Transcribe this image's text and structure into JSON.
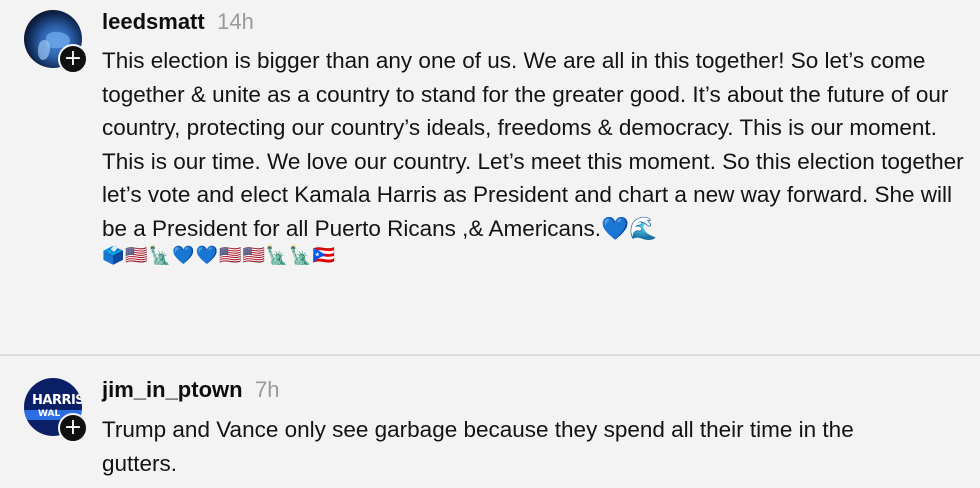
{
  "comments": [
    {
      "username": "leedsmatt",
      "time": "14h",
      "text": "This election is bigger than any one of us. We are all in this together! So let’s come together & unite as a country to stand for the greater good. It’s about the future of our country, protecting our country’s ideals, freedoms & democracy. This is our moment. This is our time. We love our country. Let’s meet this moment. So this election together let’s vote and elect Kamala Harris as President and chart a new way forward. She will be a President for all Puerto Ricans ,& Americans.💙🌊",
      "emojis": "🗳️🇺🇸🗽💙💙🇺🇸🇺🇸🗽🗽🇵🇷",
      "avatar": "earth-icon",
      "badge": "+"
    },
    {
      "username": "jim_in_ptown",
      "time": "7h",
      "text": "Trump and Vance only see garbage because they spend all their time in the gutters.",
      "avatar_text": "HARRIS",
      "avatar_subtext": "WAL",
      "badge": "+"
    }
  ],
  "colors": {
    "background": "#f3f3f3",
    "username": "#0d0d0d",
    "timestamp": "#9a9a9a",
    "avatar_harris_bg": "#0a1f66",
    "badge_bg": "#101010"
  }
}
